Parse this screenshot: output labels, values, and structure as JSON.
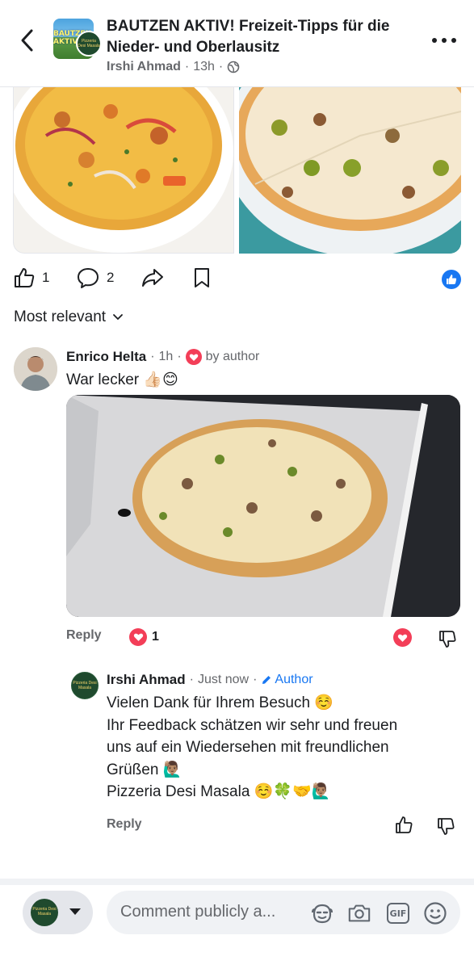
{
  "header": {
    "group_title": "BAUTZEN AKTIV! Freizeit-Tipps für die Nieder- und Oberlausitz",
    "group_avatar_text": "BAUTZEN AKTIV",
    "post_author": "Irshi Ahmad",
    "post_time": "13h",
    "visibility_icon": "globe-icon",
    "badge_text": "Pizzeria Desi Masala"
  },
  "post": {
    "photos": [
      "pizza-photo-1",
      "pizza-photo-2"
    ],
    "like_count": "1",
    "comment_count": "2",
    "like_badge_color": "#1877f2"
  },
  "sort": {
    "label": "Most relevant"
  },
  "comments": [
    {
      "author": "Enrico Helta",
      "time": "1h",
      "loved_by": "by author",
      "text": "War lecker 👍🏻😊",
      "reply_label": "Reply",
      "reaction_count": "1"
    },
    {
      "author": "Irshi Ahmad",
      "time": "Just now",
      "tag": "Author",
      "lines": [
        "Vielen Dank für Ihrem Besuch ☺️",
        "Ihr Feedback schätzen wir sehr und freuen",
        "uns auf ein Wiedersehen mit freundlichen",
        "Grüßen 🙋🏽‍♂️",
        "Pizzeria Desi Masala ☺️🍀🤝🙋🏽‍♂️"
      ],
      "reply_label": "Reply"
    }
  ],
  "composer": {
    "placeholder": "Comment publicly a..."
  },
  "colors": {
    "accent": "#1877f2",
    "love": "#f33e58"
  }
}
